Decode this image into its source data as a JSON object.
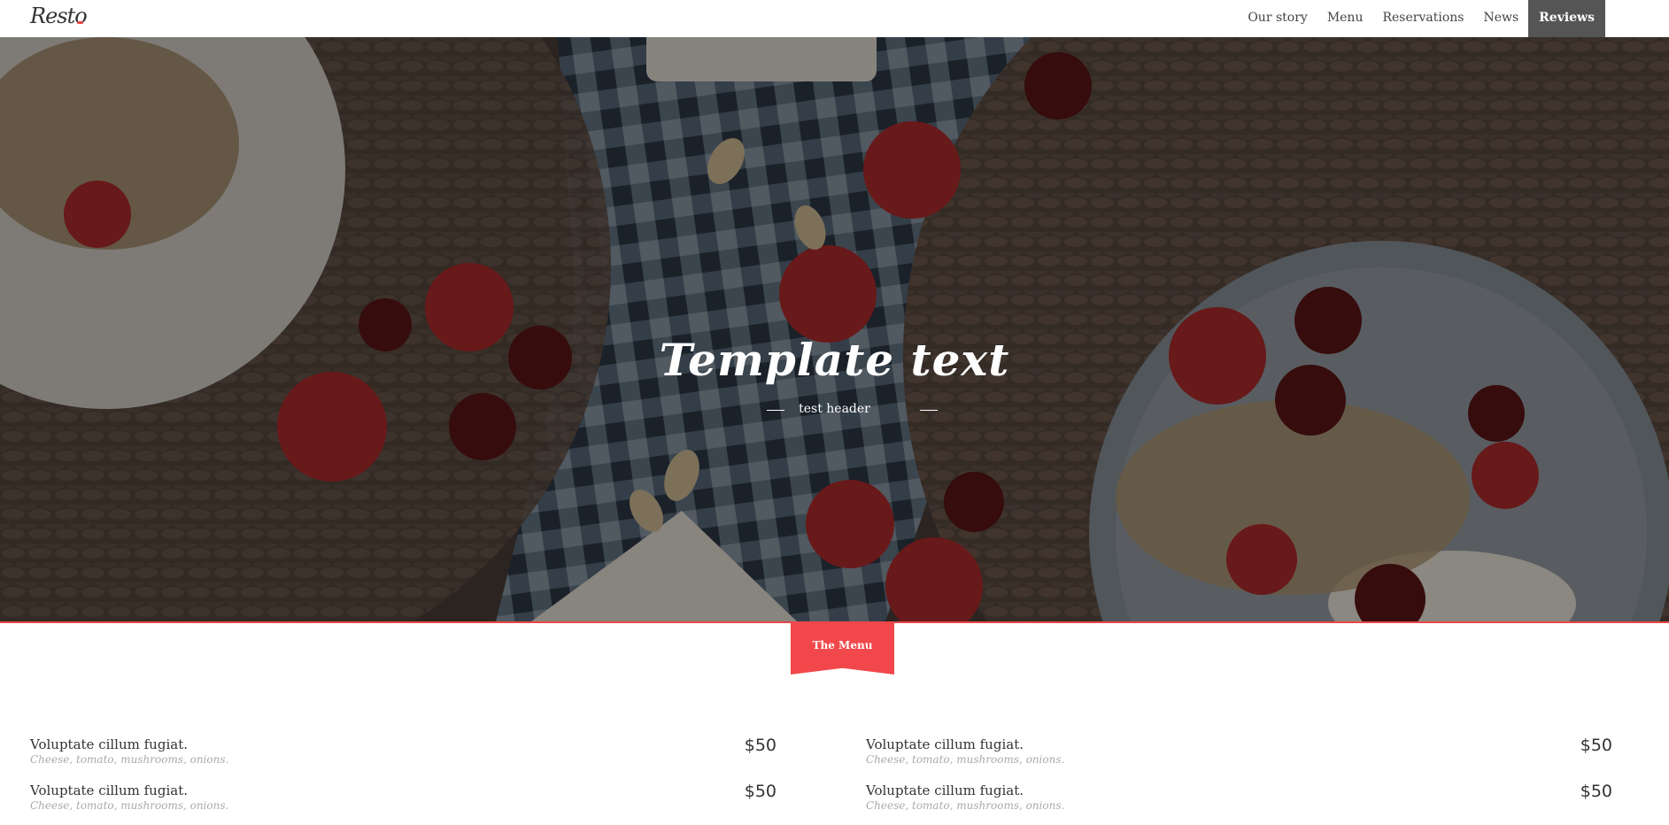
{
  "brand": {
    "logo_text": "Resto",
    "accent_color": "#e8484a"
  },
  "nav": {
    "items": [
      {
        "label": "Our story",
        "active": false
      },
      {
        "label": "Menu",
        "active": false
      },
      {
        "label": "Reservations",
        "active": false
      },
      {
        "label": "News",
        "active": false
      },
      {
        "label": "Reviews",
        "active": true
      }
    ]
  },
  "hero": {
    "title": "Template text",
    "subtitle": "test header"
  },
  "section": {
    "ribbon_label": "The Menu"
  },
  "menu": {
    "left": [
      {
        "name": "Voluptate cillum fugiat.",
        "desc": "Cheese, tomato, mushrooms, onions.",
        "price": "$50"
      },
      {
        "name": "Voluptate cillum fugiat.",
        "desc": "Cheese, tomato, mushrooms, onions.",
        "price": "$50"
      }
    ],
    "right": [
      {
        "name": "Voluptate cillum fugiat.",
        "desc": "Cheese, tomato, mushrooms, onions.",
        "price": "$50"
      },
      {
        "name": "Voluptate cillum fugiat.",
        "desc": "Cheese, tomato, mushrooms, onions.",
        "price": "$50"
      }
    ]
  }
}
